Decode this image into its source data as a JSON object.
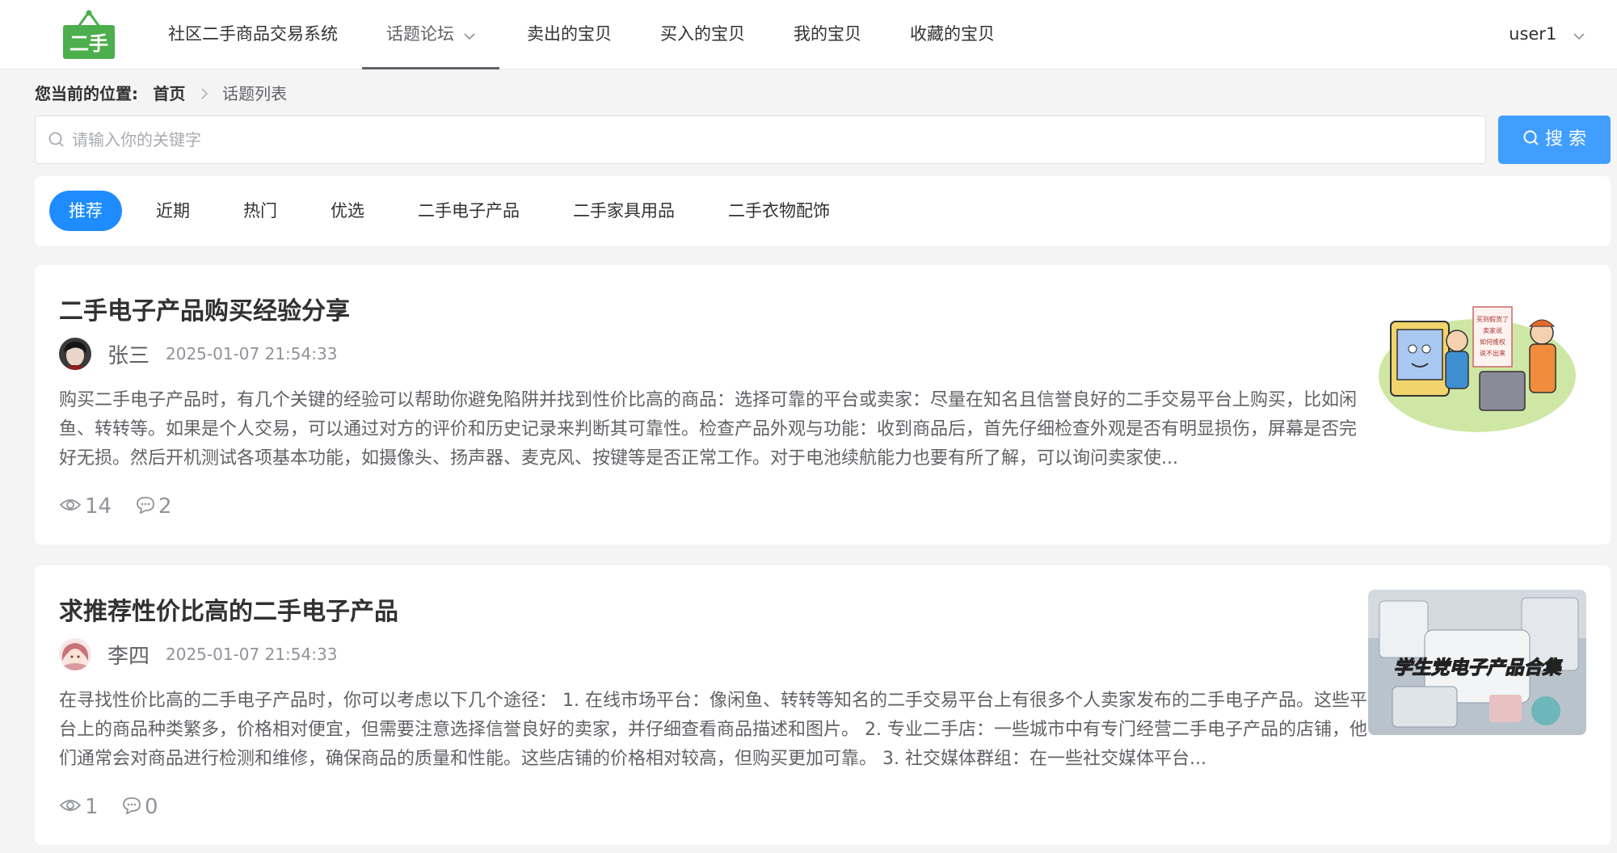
{
  "header": {
    "brand": "社区二手商品交易系统",
    "logo_text": "二手",
    "nav": [
      {
        "label": "话题论坛"
      },
      {
        "label": "卖出的宝贝"
      },
      {
        "label": "买入的宝贝"
      },
      {
        "label": "我的宝贝"
      },
      {
        "label": "收藏的宝贝"
      }
    ],
    "user": "user1"
  },
  "breadcrumb": {
    "label": "您当前的位置:",
    "home": "首页",
    "current": "话题列表"
  },
  "search": {
    "placeholder": "请输入你的关键字",
    "button": "搜 索"
  },
  "tabs": [
    "推荐",
    "近期",
    "热门",
    "优选",
    "二手电子产品",
    "二手家具用品",
    "二手衣物配饰"
  ],
  "posts": [
    {
      "title": "二手电子产品购买经验分享",
      "author": "张三",
      "time": "2025-01-07 21:54:33",
      "excerpt": "购买二手电子产品时，有几个关键的经验可以帮助你避免陷阱并找到性价比高的商品：选择可靠的平台或卖家：尽量在知名且信誉良好的二手交易平台上购买，比如闲鱼、转转等。如果是个人交易，可以通过对方的评价和历史记录来判断其可靠性。检查产品外观与功能：收到商品后，首先仔细检查外观是否有明显损伤，屏幕是否完好无损。然后开机测试各项基本功能，如摄像头、扬声器、麦克风、按键等是否正常工作。对于电池续航能力也要有所了解，可以询问卖家使...",
      "views": "14",
      "comments": "2",
      "thumb_text": [
        "买到假货了",
        "卖家说",
        "如何维权",
        "说不出来"
      ]
    },
    {
      "title": "求推荐性价比高的二手电子产品",
      "author": "李四",
      "time": "2025-01-07 21:54:33",
      "excerpt": "在寻找性价比高的二手电子产品时，你可以考虑以下几个途径： 1. 在线市场平台：像闲鱼、转转等知名的二手交易平台上有很多个人卖家发布的二手电子产品。这些平台上的商品种类繁多，价格相对便宜，但需要注意选择信誉良好的卖家，并仔细查看商品描述和图片。 2. 专业二手店：一些城市中有专门经营二手电子产品的店铺，他们通常会对商品进行检测和维修，确保商品的质量和性能。这些店铺的价格相对较高，但购买更加可靠。 3. 社交媒体群组：在一些社交媒体平台...",
      "views": "1",
      "comments": "0",
      "thumb_text": "学生党电子产品合集"
    }
  ],
  "colors": {
    "primary": "#409eff",
    "tab_active": "#1e8cff",
    "logo_green": "#4cae4c"
  }
}
